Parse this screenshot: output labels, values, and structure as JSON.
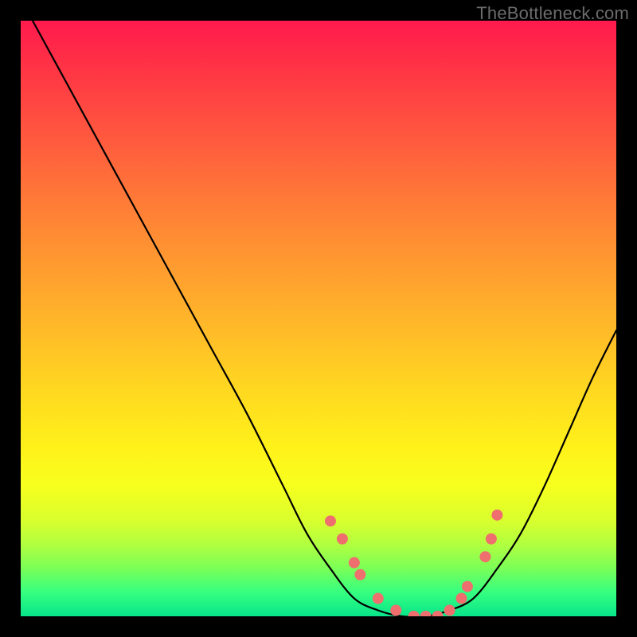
{
  "watermark": "TheBottleneck.com",
  "colors": {
    "dot": "#ef6e6e",
    "curve": "#000000"
  },
  "chart_data": {
    "type": "line",
    "title": "",
    "xlabel": "",
    "ylabel": "",
    "xlim": [
      0,
      100
    ],
    "ylim": [
      0,
      100
    ],
    "annotations": [
      "TheBottleneck.com"
    ],
    "grid": false,
    "legend": false,
    "series": [
      {
        "name": "curve",
        "x": [
          2,
          8,
          14,
          20,
          26,
          32,
          38,
          44,
          48,
          52,
          56,
          60,
          64,
          68,
          72,
          76,
          80,
          84,
          88,
          92,
          96,
          100
        ],
        "y": [
          100,
          89,
          78,
          67,
          56,
          45,
          34,
          22,
          14,
          8,
          3,
          1,
          0,
          0,
          1,
          3,
          8,
          14,
          22,
          31,
          40,
          48
        ]
      }
    ],
    "highlight_points": {
      "name": "dots",
      "x": [
        52,
        54,
        56,
        57,
        60,
        63,
        66,
        68,
        70,
        72,
        74,
        75,
        78,
        79,
        80
      ],
      "y": [
        16,
        13,
        9,
        7,
        3,
        1,
        0,
        0,
        0,
        1,
        3,
        5,
        10,
        13,
        17
      ]
    }
  }
}
